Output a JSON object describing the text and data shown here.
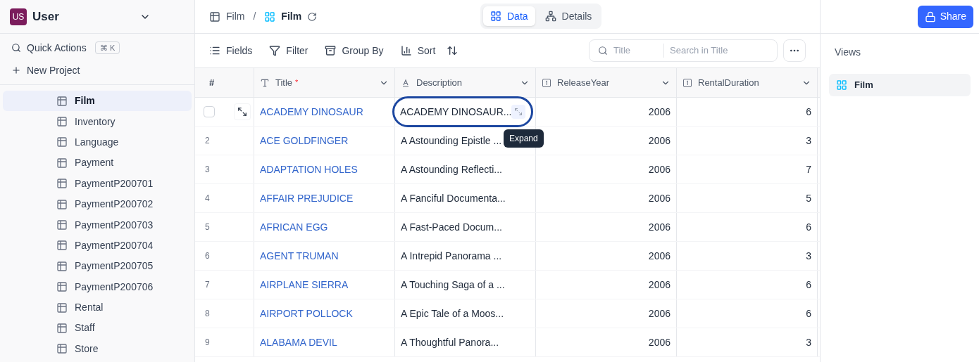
{
  "workspace": {
    "initials": "US",
    "name": "User"
  },
  "sidebar": {
    "quick_actions": {
      "label": "Quick Actions",
      "shortcut": "⌘ K"
    },
    "new_project": "New Project",
    "items": [
      {
        "label": "Film",
        "selected": true
      },
      {
        "label": "Inventory",
        "selected": false
      },
      {
        "label": "Language",
        "selected": false
      },
      {
        "label": "Payment",
        "selected": false
      },
      {
        "label": "PaymentP200701",
        "selected": false
      },
      {
        "label": "PaymentP200702",
        "selected": false
      },
      {
        "label": "PaymentP200703",
        "selected": false
      },
      {
        "label": "PaymentP200704",
        "selected": false
      },
      {
        "label": "PaymentP200705",
        "selected": false
      },
      {
        "label": "PaymentP200706",
        "selected": false
      },
      {
        "label": "Rental",
        "selected": false
      },
      {
        "label": "Staff",
        "selected": false
      },
      {
        "label": "Store",
        "selected": false
      }
    ]
  },
  "breadcrumb": {
    "table": "Film",
    "separator": "/",
    "view": "Film"
  },
  "tabs": [
    {
      "label": "Data",
      "selected": true
    },
    {
      "label": "Details",
      "selected": false
    }
  ],
  "share_button": "Share",
  "toolbar": [
    "Fields",
    "Filter",
    "Group By",
    "Sort"
  ],
  "search": {
    "field": "Title",
    "placeholder": "Search in Title"
  },
  "table": {
    "number_header": "#",
    "columns": [
      {
        "kind": "text",
        "label": "Title",
        "required_mark": "*"
      },
      {
        "kind": "longtext",
        "label": "Description"
      },
      {
        "kind": "number",
        "label": "ReleaseYear"
      },
      {
        "kind": "number",
        "label": "RentalDuration"
      }
    ],
    "rows": [
      {
        "hovered": true,
        "cells": [
          "ACADEMY DINOSAUR",
          "ACADEMY DINOSAUR...",
          "2006",
          "6"
        ],
        "description_focused": true,
        "tooltip": "Expand"
      },
      {
        "number": "2",
        "hovered": false,
        "cells": [
          "ACE GOLDFINGER",
          "A Astounding Epistle ...",
          "2006",
          "3"
        ]
      },
      {
        "number": "3",
        "hovered": false,
        "cells": [
          "ADAPTATION HOLES",
          "A Astounding Reflecti...",
          "2006",
          "7"
        ]
      },
      {
        "number": "4",
        "hovered": false,
        "cells": [
          "AFFAIR PREJUDICE",
          "A Fanciful Documenta...",
          "2006",
          "5"
        ]
      },
      {
        "number": "5",
        "hovered": false,
        "cells": [
          "AFRICAN EGG",
          "A Fast-Paced Docum...",
          "2006",
          "6"
        ]
      },
      {
        "number": "6",
        "hovered": false,
        "cells": [
          "AGENT TRUMAN",
          "A Intrepid Panorama ...",
          "2006",
          "3"
        ]
      },
      {
        "number": "7",
        "hovered": false,
        "cells": [
          "AIRPLANE SIERRA",
          "A Touching Saga of a ...",
          "2006",
          "6"
        ]
      },
      {
        "number": "8",
        "hovered": false,
        "cells": [
          "AIRPORT POLLOCK",
          "A Epic Tale of a Moos...",
          "2006",
          "6"
        ]
      },
      {
        "number": "9",
        "hovered": false,
        "cells": [
          "ALABAMA DEVIL",
          "A Thoughtful Panora...",
          "2006",
          "3"
        ]
      }
    ]
  },
  "views": {
    "title": "Views",
    "items": [
      {
        "label": "Film",
        "selected": true
      }
    ]
  }
}
